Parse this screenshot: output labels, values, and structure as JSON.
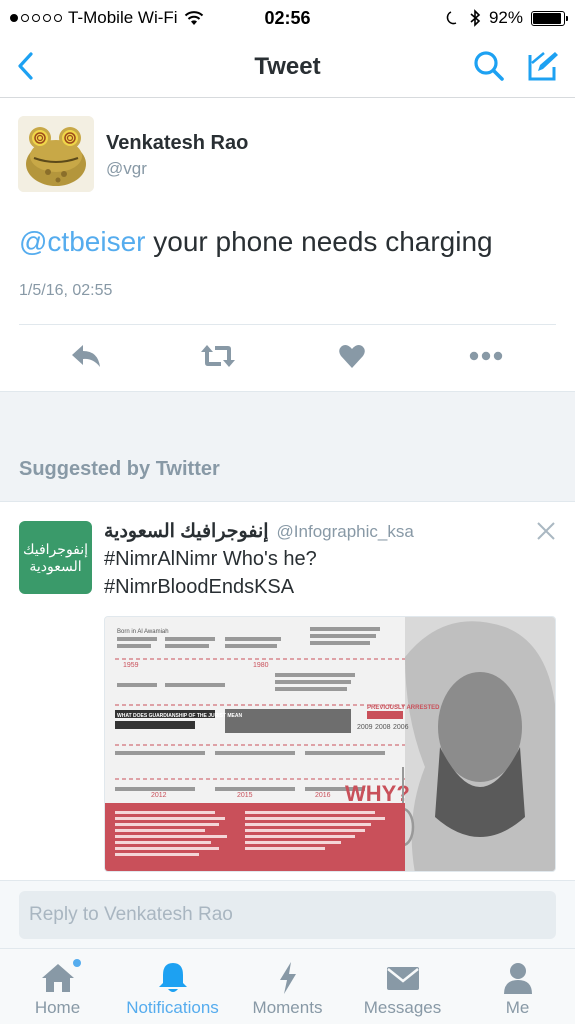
{
  "status_bar": {
    "carrier": "T-Mobile Wi-Fi",
    "time": "02:56",
    "battery_percent": "92%",
    "battery_level": 0.92,
    "signal_dots_filled": 1,
    "signal_dots_total": 5
  },
  "nav": {
    "title": "Tweet",
    "back_icon": "chevron-left-icon",
    "search_icon": "search-icon",
    "compose_icon": "compose-icon"
  },
  "tweet": {
    "author_name": "Venkatesh Rao",
    "author_handle": "@vgr",
    "mention": "@ctbeiser",
    "text": " your phone needs charging",
    "timestamp": "1/5/16, 02:55",
    "actions": [
      "reply-icon",
      "retweet-icon",
      "like-icon",
      "more-icon"
    ]
  },
  "suggested_section": {
    "heading": "Suggested by Twitter"
  },
  "suggested_tweet": {
    "avatar_line1": "إنفوجرافيك",
    "avatar_line2": "السعودية",
    "name": "إنفوجرافيك السعودية",
    "handle": "@Infographic_ksa",
    "line1": "#NimrAlNimr Who's he?",
    "line2": "#NimrBloodEndsKSA",
    "infographic": {
      "labels": [
        "Born in Al Awamiah",
        "1959",
        "1980",
        "2012",
        "2015",
        "2016",
        "2009",
        "2008",
        "2006"
      ],
      "heading_left": "WHAT DOES GUARDIANSHIP OF THE JURIST MEAN",
      "heading_right": "PREVIOUSLY ARRESTED",
      "why": "WHY?"
    }
  },
  "reply": {
    "placeholder": "Reply to Venkatesh Rao"
  },
  "tabs": [
    {
      "label": "Home",
      "icon": "home-icon"
    },
    {
      "label": "Notifications",
      "icon": "bell-icon"
    },
    {
      "label": "Moments",
      "icon": "lightning-icon"
    },
    {
      "label": "Messages",
      "icon": "envelope-icon"
    },
    {
      "label": "Me",
      "icon": "person-icon"
    }
  ],
  "colors": {
    "accent": "#55acee",
    "muted": "#8899a6",
    "text": "#292f33",
    "infographic_red": "#c9505a"
  }
}
